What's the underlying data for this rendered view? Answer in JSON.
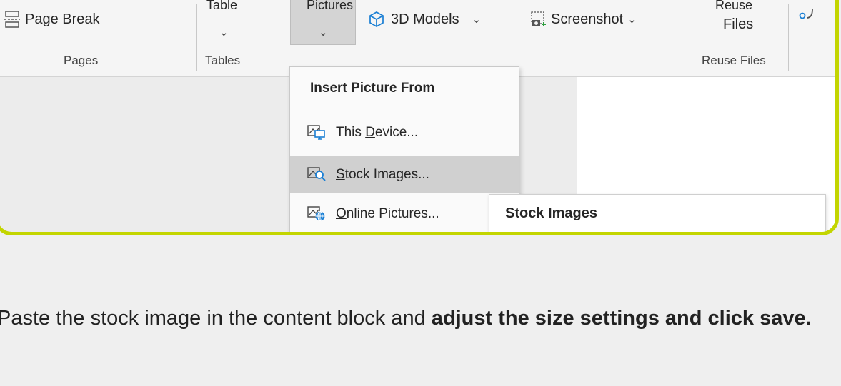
{
  "ribbon": {
    "page_break_label": "Page Break",
    "table_label_partial": "Table",
    "pictures_label_partial": "Pictures",
    "models_label": "3D Models",
    "screenshot_label": "Screenshot",
    "reuse_label_partial": "Reuse",
    "reuse_files_label": "Files",
    "groups": {
      "pages": "Pages",
      "tables": "Tables",
      "reuse_files": "Reuse Files"
    },
    "chevron": "⌄"
  },
  "menu": {
    "header": "Insert Picture From",
    "items": [
      {
        "label_access": "This ",
        "label_key": "D",
        "label_rest": "evice...",
        "icon": "device-picture-icon",
        "selected": false
      },
      {
        "label_access": "",
        "label_key": "S",
        "label_rest": "tock Images...",
        "icon": "stock-images-icon",
        "selected": true
      },
      {
        "label_access": "",
        "label_key": "O",
        "label_rest": "nline Pictures...",
        "icon": "online-pictures-icon",
        "selected": false
      }
    ]
  },
  "tooltip": {
    "title": "Stock Images"
  },
  "instruction": {
    "plain": "Paste the stock image in the content block and ",
    "bold": "adjust the size settings and click save."
  },
  "colors": {
    "frame_accent": "#c3d500",
    "icon_blue": "#1a7fd4"
  }
}
